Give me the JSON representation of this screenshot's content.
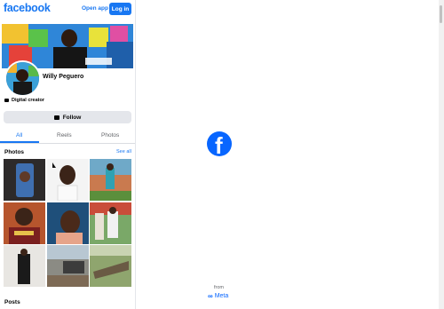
{
  "header": {
    "logo": "facebook",
    "open_app": "Open app",
    "login": "Log in"
  },
  "profile": {
    "name": "Willy Peguero",
    "category": "Digital creator",
    "follow": "Follow"
  },
  "tabs": [
    {
      "label": "All",
      "active": true
    },
    {
      "label": "Reels"
    },
    {
      "label": "Photos"
    }
  ],
  "photos": {
    "heading": "Photos",
    "see_all": "See all"
  },
  "posts": {
    "heading": "Posts"
  },
  "splash": {
    "from": "from",
    "meta": "Meta"
  },
  "colors": {
    "brand": "#1877f2",
    "meta": "#0866ff"
  }
}
